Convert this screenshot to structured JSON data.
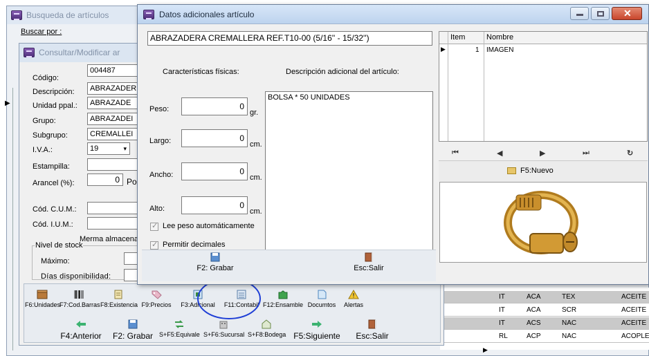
{
  "back_window": {
    "title": "Busqueda de artículos",
    "search_label": "Buscar por :"
  },
  "mid_window": {
    "title": "Consultar/Modificar ar",
    "fields": {
      "codigo_label": "Código:",
      "codigo_value": "004487",
      "descripcion_label": "Descripción:",
      "descripcion_value": "ABRAZADER",
      "unidad_label": "Unidad ppal.:",
      "unidad_value": "ABRAZADE",
      "grupo_label": "Grupo:",
      "grupo_value": "ABRAZADEI",
      "subgrupo_label": "Subgrupo:",
      "subgrupo_value": "CREMALLEI",
      "iva_label": "I.V.A.:",
      "iva_value": "19",
      "estampilla_label": "Estampilla:",
      "arancel_label": "Arancel (%):",
      "arancel_value": "0",
      "arancel_suffix": "Po",
      "cum_label": "Cód. C.U.M.:",
      "ium_label": "Cód. I.U.M.:",
      "merma_label": "Merma almacenar",
      "nivel_stock_label": "Nivel de stock",
      "maximo_label": "Máximo:",
      "dias_label": "Días disponibilidad:"
    },
    "toolbar_row1": [
      {
        "label": "F6:Unidades",
        "icon": "box-icon"
      },
      {
        "label": "F7:Cod.Barras",
        "icon": "barcode-icon"
      },
      {
        "label": "F8:Existencia",
        "icon": "document-icon"
      },
      {
        "label": "F9:Precios",
        "icon": "tag-icon"
      },
      {
        "label": "F3:Adicional",
        "icon": "form-icon"
      },
      {
        "label": "F11:Contabil",
        "icon": "calculator-icon"
      },
      {
        "label": "F12:Ensamble",
        "icon": "puzzle-icon"
      },
      {
        "label": "Documtos",
        "icon": "folder-icon"
      },
      {
        "label": "Alertas",
        "icon": "warning-icon"
      }
    ],
    "toolbar_row2": {
      "anterior": "F4:Anterior",
      "grabar": "F2: Grabar",
      "equivale": "S+F5:Equivale",
      "sucursal": "S+F6:Sucursal",
      "bodega": "S+F8:Bodega",
      "siguiente": "F5:Siguiente",
      "salir": "Esc:Salir"
    }
  },
  "back_grid": {
    "rows": [
      [
        "IT",
        "ACA",
        "TEX",
        "ACEITE"
      ],
      [
        "IT",
        "ACA",
        "SCR",
        "ACEITE"
      ],
      [
        "IT",
        "ACS",
        "NAC",
        "ACEITE"
      ],
      [
        "RL",
        "ACP",
        "NAC",
        "ACOPLE"
      ]
    ]
  },
  "dialog": {
    "title": "Datos adicionales artículo",
    "article_name": "ABRAZADERA CREMALLERA REF.T10-00  (5/16'' - 15/32'')",
    "caracteristicas_label": "Características físicas:",
    "descripcion_label": "Descripción adicional del artículo:",
    "descripcion_text": "BOLSA * 50 UNIDADES",
    "peso_label": "Peso:",
    "peso_value": "0",
    "peso_unit": "gr.",
    "largo_label": "Largo:",
    "largo_value": "0",
    "largo_unit": "cm.",
    "ancho_label": "Ancho:",
    "ancho_value": "0",
    "ancho_unit": "cm.",
    "alto_label": "Alto:",
    "alto_value": "0",
    "alto_unit": "cm.",
    "lee_peso_label": "Lee peso automáticamente",
    "permitir_label": "Permitir decimales",
    "grabar_label": "F2: Grabar",
    "salir_label": "Esc:Salir",
    "image_grid": {
      "headers": [
        "Item",
        "Nombre"
      ],
      "rows": [
        [
          "1",
          "IMAGEN"
        ]
      ]
    },
    "nuevo_label": "F5:Nuevo"
  },
  "colors": {
    "titlebar_active": "#c5daf3",
    "titlebar_inactive": "#dbe5f1",
    "close_button": "#c9462c",
    "highlight_circle": "#1f3fd6"
  }
}
